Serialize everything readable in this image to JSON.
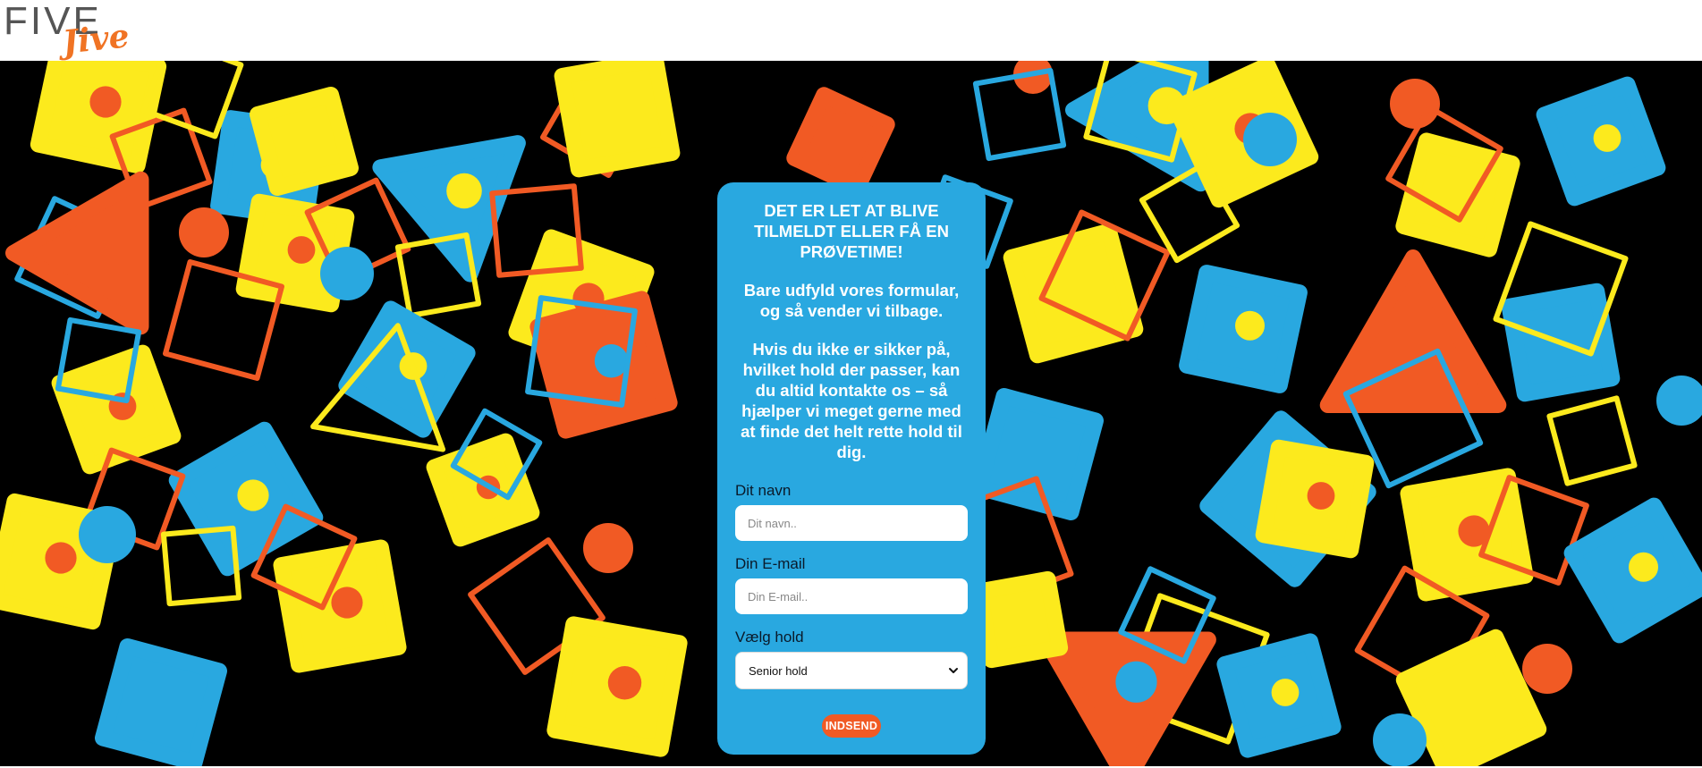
{
  "header": {
    "logo_text_top": "FIVE",
    "logo_text_bottom": "Jive"
  },
  "colors": {
    "card": "#29a8e0",
    "button": "#f15a24",
    "yellow": "#fcea1d",
    "blue": "#29a8e0",
    "orange": "#f15a24",
    "background": "#000000"
  },
  "signup_card": {
    "lead_text": "DET ER LET AT BLIVE TILMELDT ELLER FÅ EN PRØVETIME!",
    "paragraph_2": "Bare udfyld vores formular, og så vender vi tilbage.",
    "paragraph_3": "Hvis du ikke er sikker på, hvilket hold der passer, kan du altid kontakte os – så hjælper vi meget gerne med at finde det helt rette hold til dig.",
    "name_label": "Dit navn",
    "name_placeholder": "Dit navn..",
    "name_value": "",
    "email_label": "Din E-mail",
    "email_placeholder": "Din E-mail..",
    "email_value": "",
    "team_label": "Vælg hold",
    "team_selected": "Senior hold",
    "submit_label": "INDSEND"
  }
}
